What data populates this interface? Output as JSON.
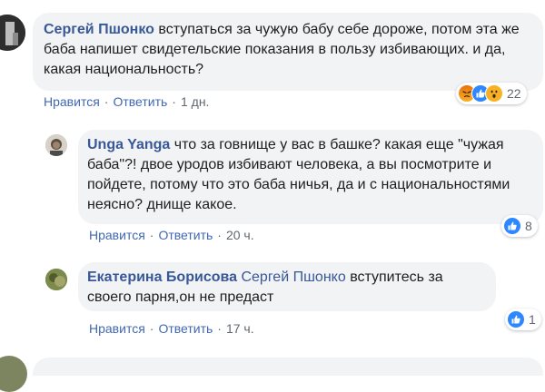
{
  "actions": {
    "like_label": "Нравится",
    "reply_label": "Ответить",
    "separator": "·"
  },
  "comments": [
    {
      "author": "Сергей Пшонко",
      "text": "вступаться за чужую бабу себе дороже, потом эта же баба напишет свидетельские показания в пользу избивающих. и да, какая национальность?",
      "time": "1 дн.",
      "reactions": [
        "angry-icon",
        "like-icon",
        "wow-icon"
      ],
      "reaction_count": "22"
    },
    {
      "author": "Unga Yanga",
      "text": "что за говнище у вас в башке? какая еще \"чужая баба\"?! двое уродов избивают человека, а вы посмотрите и пойдете, потому что это баба ничья, да и с национальностями неясно? днище какое.",
      "time": "20 ч.",
      "reactions": [
        "like-icon"
      ],
      "reaction_count": "8"
    },
    {
      "author": "Екатерина Борисова",
      "mention": "Сергей Пшонко",
      "text": "вступитесь за своего парня,он не предаст",
      "time": "17 ч.",
      "reactions": [
        "like-icon"
      ],
      "reaction_count": "1"
    }
  ],
  "colors": {
    "author_link": "#385898",
    "action_link": "#4267b2",
    "bubble_bg": "#f2f3f5",
    "like_blue": "#2d88ff"
  }
}
